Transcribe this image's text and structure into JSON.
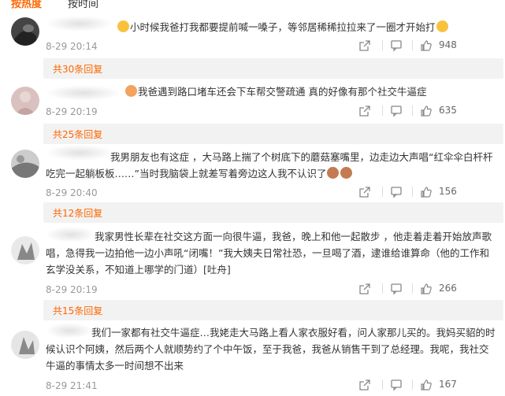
{
  "tabs": [
    "按热度",
    "按时间"
  ],
  "comments": [
    {
      "text": "小时候我爸打我都要提前喊一嗓子，等邻居稀稀拉拉来了一圈才开始打",
      "time": "8-29 20:14",
      "likes": "948",
      "replies": "共30条回复"
    },
    {
      "text": "我爸遇到路口堵车还会下车帮交警疏通 真的好像有那个社交牛逼症",
      "time": "8-29 20:19",
      "likes": "635",
      "replies": "共25条回复"
    },
    {
      "text": "我男朋友也有这症 ，大马路上揣了个树底下的蘑菇塞嘴里，边走边大声唱“红伞伞白杆杆吃完一起躺板板……”当时我脑袋上就差写着旁边这人我不认识了",
      "time": "8-29 20:40",
      "likes": "156",
      "replies": "共12条回复"
    },
    {
      "text": "我家男性长辈在社交这方面一向很牛逼，我爸，晚上和他一起散步 ，他走着走着开始放声歌唱，急得我一边拍他一边小声吼“闭嘴！”我大姨夫日常社恐，一旦喝了酒，逮谁给谁算命（他的工作和玄学没关系，不知道上哪学的门道）[吐舟]",
      "time": "8-29 20:19",
      "likes": "266",
      "replies": "共15条回复"
    },
    {
      "text": "我们一家都有社交牛逼症…我姥走大马路上看人家衣服好看，问人家那儿买的。我妈买貂的时候认识个阿姨，然后两个人就顺势约了个中午饭，至于我爸，我爸从销售干到了总经理。我呢，我社交牛逼的事情太多一时间想不出来",
      "time": "8-29 21:41",
      "likes": "167"
    }
  ]
}
